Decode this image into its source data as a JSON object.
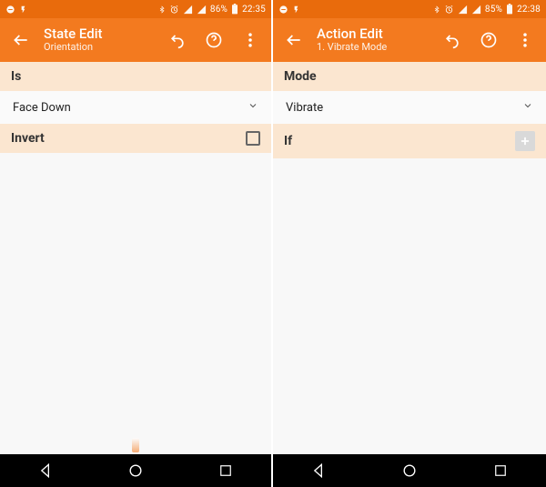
{
  "colors": {
    "primary": "#f37a1f",
    "primaryDark": "#e96b0c",
    "section": "#fbe6d0"
  },
  "left": {
    "status": {
      "battery": "86%",
      "time": "22:35"
    },
    "title": "State Edit",
    "subtitle": "Orientation",
    "sections": [
      {
        "header": "Is",
        "type": "dropdown",
        "value": "Face Down"
      },
      {
        "header": "Invert",
        "type": "checkbox"
      }
    ]
  },
  "right": {
    "status": {
      "battery": "85%",
      "time": "22:38"
    },
    "title": "Action Edit",
    "subtitle": "1. Vibrate Mode",
    "sections": [
      {
        "header": "Mode",
        "type": "dropdown",
        "value": "Vibrate"
      },
      {
        "header": "If",
        "type": "add"
      }
    ]
  }
}
